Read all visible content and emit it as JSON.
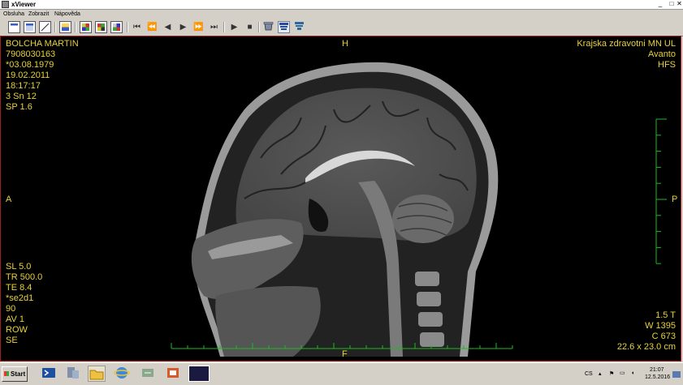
{
  "window": {
    "title": "xViewer",
    "minimize_glyph": "_",
    "maximize_glyph": "□",
    "close_glyph": "✕"
  },
  "menu": {
    "items": [
      "Obsluha",
      "Zobrazit",
      "Nápověda"
    ]
  },
  "toolbar": {
    "icons": [
      "layout-1-icon",
      "layout-2-icon",
      "edit-icon",
      "export-icon",
      "grid-icon",
      "grid-multi-icon",
      "grid-color-icon"
    ],
    "nav_glyphs": [
      "⏮",
      "⏪",
      "◀",
      "▶",
      "⏩",
      "⏭"
    ],
    "play_glyphs": [
      "▶",
      "■"
    ],
    "tool_icons": [
      "dicom-server-icon",
      "network-node-icon",
      "network-node-2-icon"
    ]
  },
  "overlay": {
    "top_left": [
      "BOLCHA MARTIN",
      "7908030163",
      "*03.08.1979",
      "19.02.2011",
      "18:17:17",
      "3 Sn 12",
      "SP 1.6"
    ],
    "top_right": [
      "Krajska zdravotni MN UL",
      "Avanto",
      "HFS"
    ],
    "bottom_left": [
      "SL 5.0",
      "TR 500.0",
      "TE 8.4",
      "*se2d1",
      "90",
      "AV 1",
      "ROW",
      "SE"
    ],
    "bottom_right": [
      "1.5 T",
      "W 1395",
      "C 673",
      "22.6 x 23.0 cm"
    ],
    "orientation": {
      "top": "H",
      "bottom": "F",
      "left": "A",
      "right": "P"
    },
    "text_color": "#e8d23a",
    "ruler_color": "#1fb81f"
  },
  "taskbar": {
    "start_label": "Start",
    "apps": [
      "powershell-icon",
      "server-manager-icon",
      "explorer-icon",
      "ie-icon",
      "network-icon",
      "app-icon",
      "xviewer-icon"
    ],
    "language": "CS",
    "time": "21:07",
    "date": "12.5.2016"
  }
}
